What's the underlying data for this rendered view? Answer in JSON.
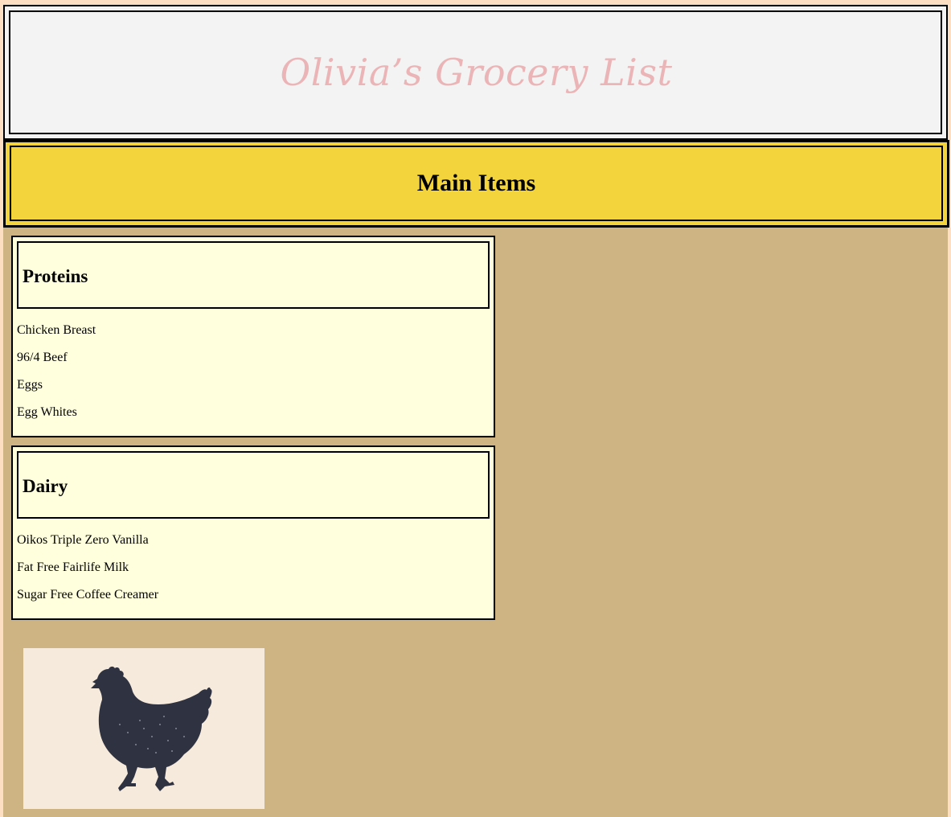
{
  "header": {
    "title": "Olivia’s Grocery List"
  },
  "section": {
    "title": "Main Items"
  },
  "proteins": {
    "title": "Proteins",
    "items": [
      "Chicken Breast",
      "96/4 Beef",
      "Eggs",
      "Egg Whites"
    ]
  },
  "dairy": {
    "title": "Dairy",
    "items": [
      "Oikos Triple Zero Vanilla",
      "Fat Free Fairlife Milk",
      "Sugar Free Coffee Creamer"
    ]
  },
  "image": {
    "icon": "hen-icon"
  },
  "colors": {
    "page_bg": "#fde0c4",
    "content_bg": "#ceb383",
    "title_bg": "#f3f3f3",
    "title_text": "#ebb5b7",
    "section_bg": "#f3d43d",
    "card_bg": "#ffffdd",
    "hen": "#2f3240",
    "hen_bg": "#f6eadc"
  }
}
